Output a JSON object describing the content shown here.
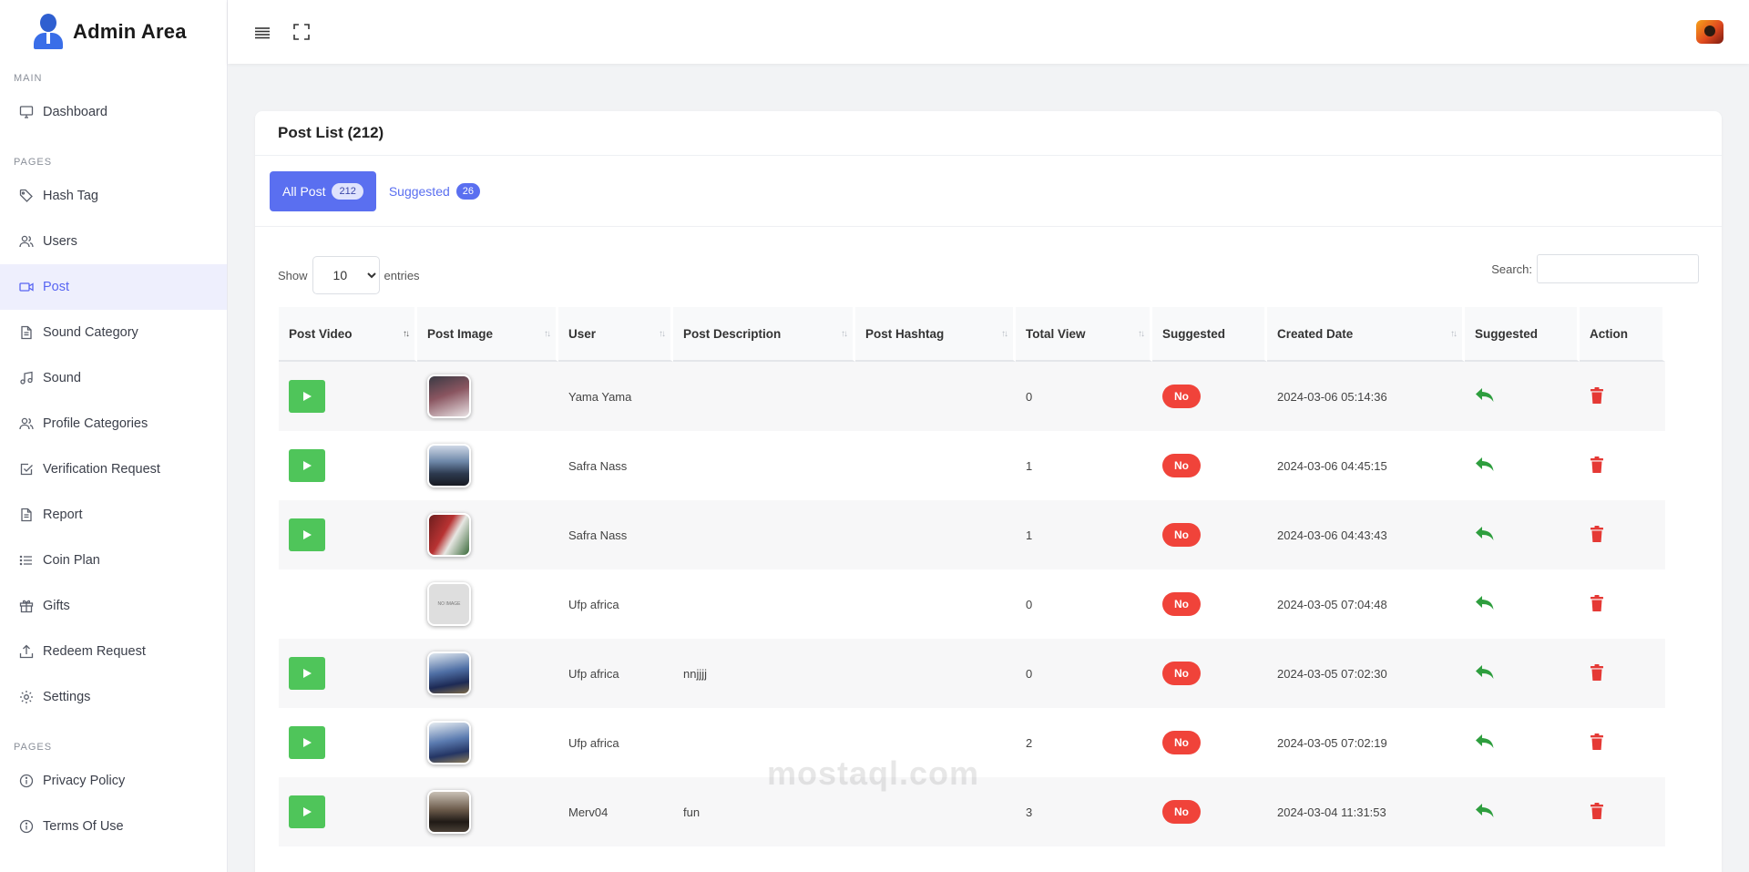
{
  "brand": {
    "title": "Admin Area"
  },
  "sidebar": {
    "sections": [
      {
        "label": "MAIN",
        "items": [
          {
            "label": "Dashboard",
            "icon": "monitor-icon",
            "active": false
          }
        ]
      },
      {
        "label": "PAGES",
        "items": [
          {
            "label": "Hash Tag",
            "icon": "tag-icon",
            "active": false
          },
          {
            "label": "Users",
            "icon": "users-icon",
            "active": false
          },
          {
            "label": "Post",
            "icon": "video-icon",
            "active": true
          },
          {
            "label": "Sound Category",
            "icon": "file-icon",
            "active": false
          },
          {
            "label": "Sound",
            "icon": "music-icon",
            "active": false
          },
          {
            "label": "Profile Categories",
            "icon": "users-icon",
            "active": false
          },
          {
            "label": "Verification Request",
            "icon": "check-square-icon",
            "active": false
          },
          {
            "label": "Report",
            "icon": "file-icon",
            "active": false
          },
          {
            "label": "Coin Plan",
            "icon": "list-icon",
            "active": false
          },
          {
            "label": "Gifts",
            "icon": "gift-icon",
            "active": false
          },
          {
            "label": "Redeem Request",
            "icon": "upload-icon",
            "active": false
          },
          {
            "label": "Settings",
            "icon": "gear-icon",
            "active": false
          }
        ]
      },
      {
        "label": "PAGES",
        "items": [
          {
            "label": "Privacy Policy",
            "icon": "info-icon",
            "active": false
          },
          {
            "label": "Terms Of Use",
            "icon": "info-icon",
            "active": false
          }
        ]
      }
    ]
  },
  "page": {
    "title": "Post List (212)"
  },
  "tabs": [
    {
      "label": "All Post",
      "count": "212",
      "active": true
    },
    {
      "label": "Suggested",
      "count": "26",
      "active": false
    }
  ],
  "controls": {
    "show_label": "Show",
    "entries_value": "10",
    "entries_label": "entries",
    "search_label": "Search:"
  },
  "table": {
    "columns": [
      "Post Video",
      "Post Image",
      "User",
      "Post Description",
      "Post Hashtag",
      "Total View",
      "Suggested",
      "Created Date",
      "Suggested",
      "Action"
    ],
    "rows": [
      {
        "has_video": true,
        "image": "photo",
        "user": "Yama Yama",
        "description": "",
        "hashtag": "",
        "views": "0",
        "suggested": "No",
        "created": "2024-03-06 05:14:36"
      },
      {
        "has_video": true,
        "image": "photo",
        "user": "Safra Nass",
        "description": "",
        "hashtag": "",
        "views": "1",
        "suggested": "No",
        "created": "2024-03-06 04:45:15"
      },
      {
        "has_video": true,
        "image": "photo",
        "user": "Safra Nass",
        "description": "",
        "hashtag": "",
        "views": "1",
        "suggested": "No",
        "created": "2024-03-06 04:43:43"
      },
      {
        "has_video": false,
        "image": "no-image",
        "user": "Ufp africa",
        "description": "",
        "hashtag": "",
        "views": "0",
        "suggested": "No",
        "created": "2024-03-05 07:04:48"
      },
      {
        "has_video": true,
        "image": "photo",
        "user": "Ufp africa",
        "description": "nnjjjj",
        "hashtag": "",
        "views": "0",
        "suggested": "No",
        "created": "2024-03-05 07:02:30"
      },
      {
        "has_video": true,
        "image": "photo",
        "user": "Ufp africa",
        "description": "",
        "hashtag": "",
        "views": "2",
        "suggested": "No",
        "created": "2024-03-05 07:02:19"
      },
      {
        "has_video": true,
        "image": "photo",
        "user": "Merv04",
        "description": "fun",
        "hashtag": "",
        "views": "3",
        "suggested": "No",
        "created": "2024-03-04 11:31:53"
      }
    ]
  },
  "colors": {
    "accent": "#5a6ff0",
    "play_button": "#4fc55a",
    "badge_no": "#f0433a",
    "suggest_icon": "#2e9e3e",
    "delete_icon": "#e53935"
  },
  "watermark": "mostaql.com"
}
